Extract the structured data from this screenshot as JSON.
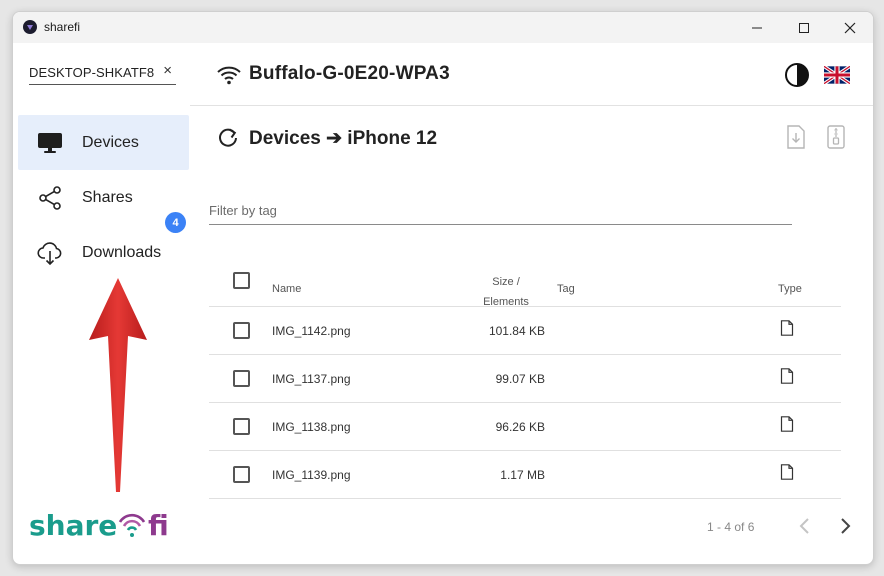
{
  "window": {
    "title": "sharefi"
  },
  "sidebar": {
    "device_name": "DESKTOP-SHKATF8",
    "clear_symbol": "×",
    "items": [
      {
        "label": "Devices",
        "icon": "monitor-icon",
        "active": true
      },
      {
        "label": "Shares",
        "icon": "share-icon",
        "active": false
      },
      {
        "label": "Downloads",
        "icon": "cloud-download-icon",
        "active": false,
        "badge": "4"
      }
    ],
    "logo_text": "sharefi"
  },
  "header": {
    "network_name": "Buffalo-G-0E20-WPA3",
    "icons": [
      "wifi-icon",
      "contrast-icon",
      "uk-flag-icon"
    ]
  },
  "content": {
    "breadcrumb": "Devices ➔ iPhone 12",
    "filter_placeholder": "Filter by tag",
    "columns": {
      "name": "Name",
      "size_line1": "Size /",
      "size_line2": "Elements",
      "tag": "Tag",
      "type": "Type"
    },
    "files": [
      {
        "name": "IMG_1142.png",
        "size": "101.84 KB",
        "tag": "",
        "type_icon": "file-icon"
      },
      {
        "name": "IMG_1137.png",
        "size": "99.07 KB",
        "tag": "",
        "type_icon": "file-icon"
      },
      {
        "name": "IMG_1138.png",
        "size": "96.26 KB",
        "tag": "",
        "type_icon": "file-icon"
      },
      {
        "name": "IMG_1139.png",
        "size": "1.17 MB",
        "tag": "",
        "type_icon": "file-icon"
      }
    ],
    "pagination": "1 - 4 of 6"
  },
  "colors": {
    "accent": "#3b82f6",
    "active_nav_bg": "#e6eefb",
    "arrow": "#d32f2f",
    "logo_teal": "#1a9c8c",
    "logo_purple": "#8e3a8e"
  }
}
